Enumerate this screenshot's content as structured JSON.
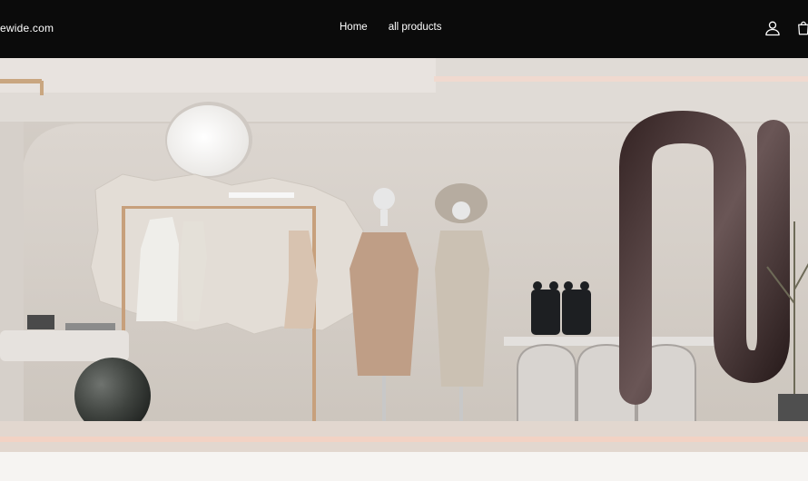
{
  "header": {
    "brand": "ewide.com",
    "nav": [
      {
        "label": "Home"
      },
      {
        "label": "all products"
      }
    ],
    "icons": {
      "account": "user-icon",
      "cart": "shopping-bag-icon"
    }
  },
  "hero": {
    "image": "store-window-mannequins-image"
  },
  "colors": {
    "header_bg": "#0b0b0b",
    "page_bg": "#f6f4f2",
    "text_on_dark": "#ffffff"
  }
}
